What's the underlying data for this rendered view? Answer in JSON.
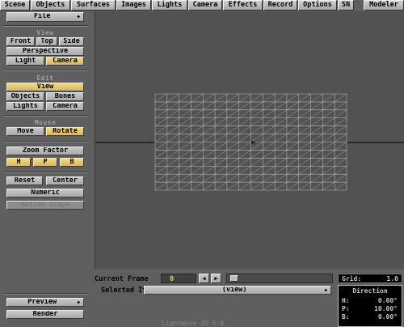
{
  "tabs": [
    "Scene",
    "Objects",
    "Surfaces",
    "Images",
    "Lights",
    "Camera",
    "Effects",
    "Record",
    "Options",
    "SN",
    "Modeler"
  ],
  "panel": {
    "file_label": "File",
    "view_section": "View",
    "view_front": "Front",
    "view_top": "Top",
    "view_side": "Side",
    "view_perspective": "Perspective",
    "view_light": "Light",
    "view_camera": "Camera",
    "edit_section": "Edit",
    "edit_view": "View",
    "edit_objects": "Objects",
    "edit_bones": "Bones",
    "edit_lights": "Lights",
    "edit_camera": "Camera",
    "mouse_section": "Mouse",
    "mouse_move": "Move",
    "mouse_rotate": "Rotate",
    "zoom_factor": "Zoom Factor",
    "h_label": "H",
    "p_label": "P",
    "b_label": "B",
    "reset": "Reset",
    "center": "Center",
    "numeric": "Numeric",
    "motion_graph": "Motion Graph",
    "preview": "Preview",
    "render": "Render"
  },
  "bottom": {
    "current_frame_label": "Current Frame",
    "current_frame_value": "0",
    "selected_item_label": "Selected Item",
    "selected_item_value": "(view)",
    "grid_label": "Grid:",
    "grid_value": "1.0"
  },
  "direction": {
    "title": "Direction",
    "h_label": "H:",
    "h_value": "0.00°",
    "p_label": "P:",
    "p_value": "10.00°",
    "b_label": "B:",
    "b_value": "0.00°"
  },
  "status_text": "LightWave 3D 5.0",
  "colors": {
    "active_button": "#e0c46a",
    "panel_bg": "#5f5f5f",
    "viewport_bg": "#525252",
    "grid_line": "#b4b4b4"
  }
}
